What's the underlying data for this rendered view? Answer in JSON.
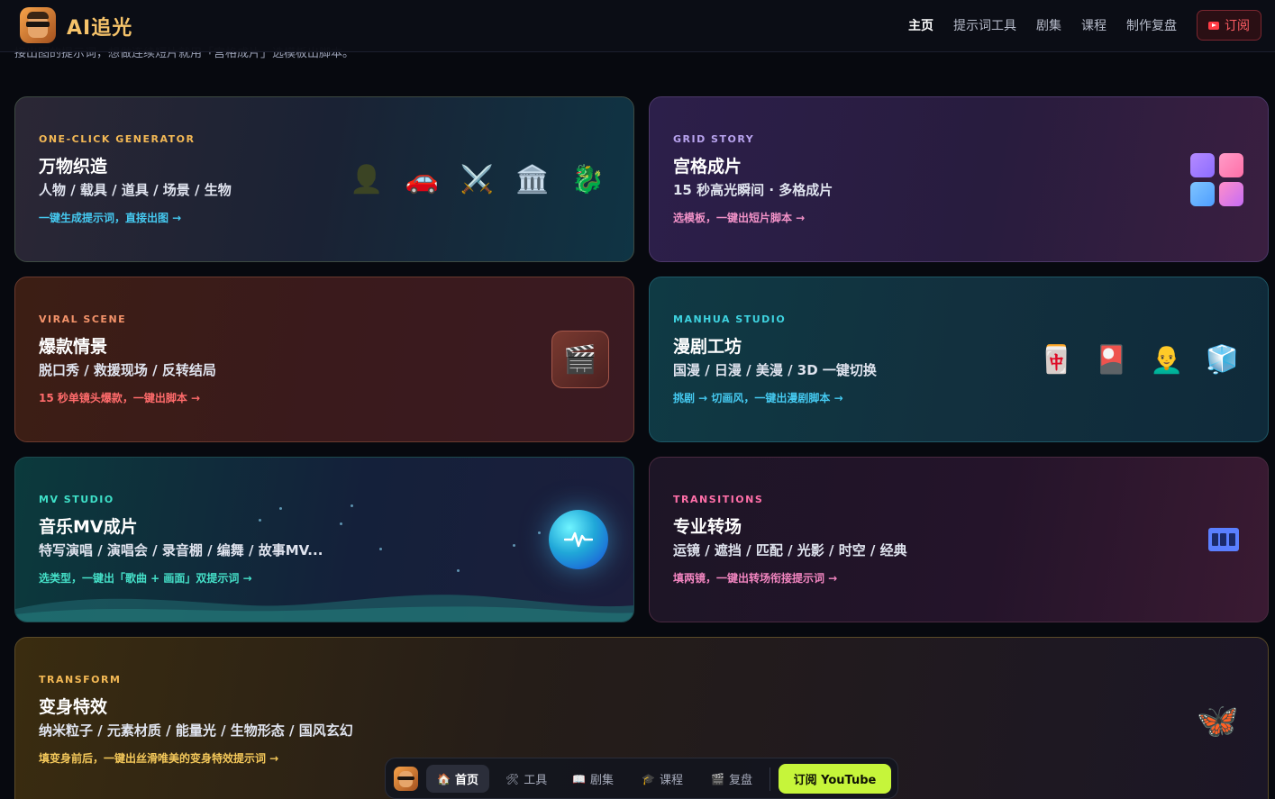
{
  "app": {
    "title": "AI追光"
  },
  "nav": {
    "items": [
      "主页",
      "提示词工具",
      "剧集",
      "课程",
      "制作复盘"
    ],
    "subscribe_label": "订阅"
  },
  "intro_text": "接出图的提示词，想做连续短片就用「宫格成片」选模板出脚本。",
  "cards": [
    {
      "eyebrow": "ONE-CLICK GENERATOR",
      "title": "万物织造",
      "subtitle": "人物 / 载具 / 道具 / 场景 / 生物",
      "cta": "一键生成提示词，直接出图 →",
      "icons": [
        "👤",
        "🚗",
        "⚔️",
        "🏛️",
        "🐉"
      ],
      "accent": "#f4b955",
      "cta_color": "#45c9f0"
    },
    {
      "eyebrow": "GRID STORY",
      "title": "宫格成片",
      "subtitle": "15 秒高光瞬间 · 多格成片",
      "cta": "选模板，一键出短片脚本 →",
      "accent": "#b9a4ef",
      "cta_color": "#f292c8"
    },
    {
      "eyebrow": "VIRAL SCENE",
      "title": "爆款情景",
      "subtitle": "脱口秀 / 救援现场 / 反转结局",
      "cta": "15 秒单镜头爆款，一键出脚本 →",
      "icons": [
        "🎬"
      ],
      "accent": "#f4936a",
      "cta_color": "#ff6b6b"
    },
    {
      "eyebrow": "MANHUA STUDIO",
      "title": "漫剧工坊",
      "subtitle": "国漫 / 日漫 / 美漫 / 3D 一键切换",
      "cta": "挑剧 → 切画风，一键出漫剧脚本 →",
      "icons": [
        "🀄",
        "🎴",
        "👨‍🦲",
        "🧊"
      ],
      "accent": "#3ed3e0",
      "cta_color": "#45c9f0"
    },
    {
      "eyebrow": "MV STUDIO",
      "title": "音乐MV成片",
      "subtitle": "特写演唱 / 演唱会 / 录音棚 / 编舞 / 故事MV...",
      "cta": "选类型，一键出「歌曲 + 画面」双提示词 →",
      "accent": "#3ee0c8",
      "cta_color": "#45e0c8"
    },
    {
      "eyebrow": "TRANSITIONS",
      "title": "专业转场",
      "subtitle": "运镜 / 遮挡 / 匹配 / 光影 / 时空 / 经典",
      "cta": "填两镜，一键出转场衔接提示词 →",
      "accent": "#ff6fa8",
      "cta_color": "#f285c0"
    },
    {
      "eyebrow": "TRANSFORM",
      "title": "变身特效",
      "subtitle": "纳米粒子 / 元素材质 / 能量光 / 生物形态 / 国风玄幻",
      "cta": "填变身前后，一键出丝滑唯美的变身特效提示词 →",
      "icons": [
        "🦋"
      ],
      "accent": "#f4b955",
      "cta_color": "#f4c85a"
    }
  ],
  "bottom_bar": {
    "items": [
      {
        "icon": "🏠",
        "label": "首页"
      },
      {
        "icon": "🛠",
        "label": "工具"
      },
      {
        "icon": "📖",
        "label": "剧集"
      },
      {
        "icon": "🎓",
        "label": "课程"
      },
      {
        "icon": "🎬",
        "label": "复盘"
      }
    ],
    "youtube_label": "订阅 YouTube"
  }
}
